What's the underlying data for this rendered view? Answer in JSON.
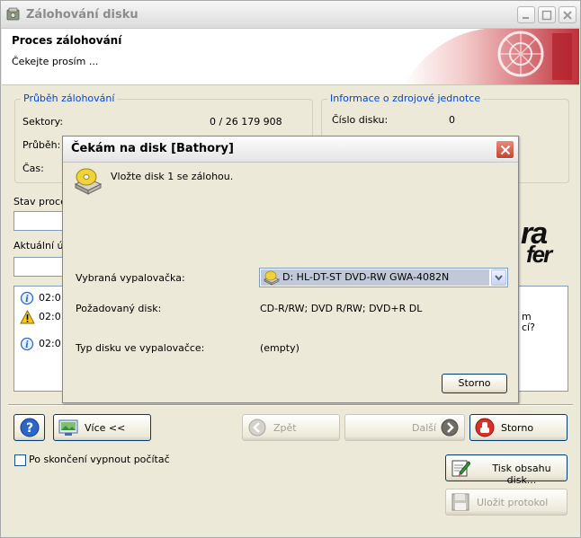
{
  "window": {
    "title": "Zálohování disku"
  },
  "header": {
    "title": "Proces zálohování",
    "subtitle": "Čekejte prosím ..."
  },
  "progress_group": {
    "legend": "Průběh zálohování",
    "sectors_label": "Sektory:",
    "sectors_value": "0 / 26 179 908",
    "progress_label": "Průběh:",
    "time_label": "Čas:"
  },
  "source_group": {
    "legend": "Informace o zdrojové jednotce",
    "disk_number_label": "Číslo disku:",
    "disk_number_value": "0"
  },
  "status": {
    "state_label": "Stav proces",
    "current_label": "Aktuální úk"
  },
  "log": [
    {
      "icon": "info",
      "time": "02:01"
    },
    {
      "icon": "warning",
      "time": "02:01"
    },
    {
      "icon": "info",
      "time": "02:01"
    }
  ],
  "log_right": {
    "line1": "m",
    "line2": "cí?"
  },
  "brand": {
    "line1": "ra",
    "line2": "fer"
  },
  "buttons": {
    "help": "?",
    "more": "Více <<",
    "back": "Zpět",
    "next": "Další",
    "cancel": "Storno",
    "print": "Tisk obsahu disk...",
    "save_log": "Uložit protokol"
  },
  "shutdown_checkbox": {
    "label": "Po skončení vypnout počítač",
    "checked": false
  },
  "dialog": {
    "title": "Čekám na disk [Bathory]",
    "message": "Vložte disk 1 se zálohou.",
    "burner_label": "Vybraná vypalovačka:",
    "burner_value": "D: HL-DT-ST DVD-RW GWA-4082N",
    "required_label": "Požadovaný disk:",
    "required_value": "CD-R/RW; DVD R/RW; DVD+R DL",
    "type_label": "Typ disku ve vypalovačce:",
    "type_value": "(empty)",
    "cancel": "Storno"
  }
}
